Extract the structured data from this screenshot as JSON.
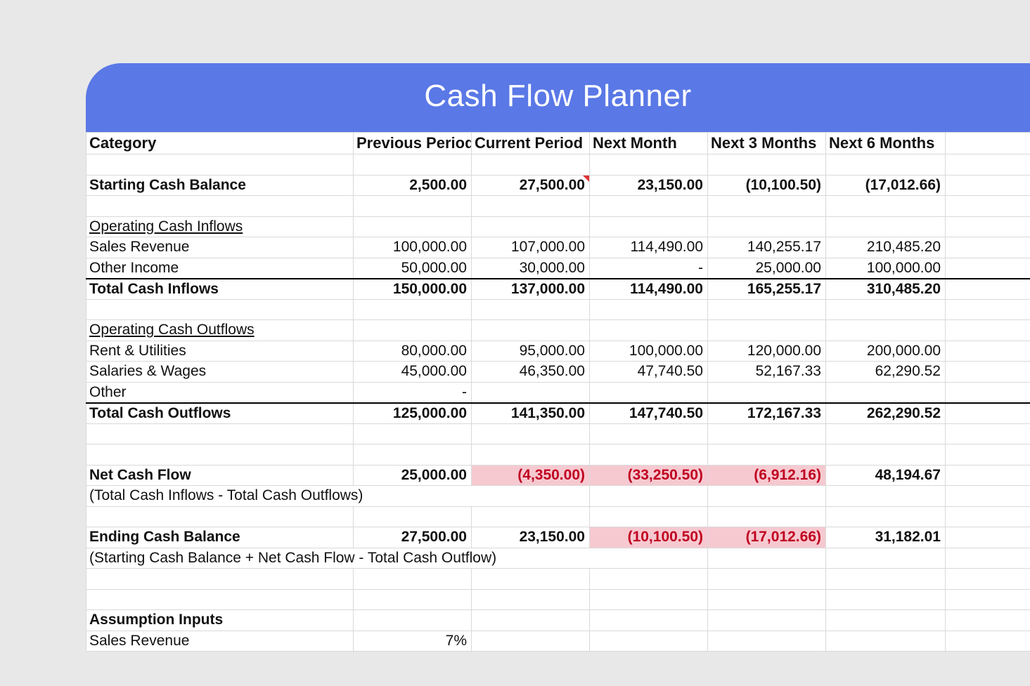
{
  "title": "Cash Flow Planner",
  "columns": [
    "Category",
    "Previous Period",
    "Current Period",
    "Next Month",
    "Next 3 Months",
    "Next 6 Months"
  ],
  "rows": {
    "starting": {
      "label": "Starting Cash Balance",
      "vals": [
        "2,500.00",
        "27,500.00",
        "23,150.00",
        "(10,100.50)",
        "(17,012.66)"
      ],
      "neg": [
        false,
        false,
        false,
        true,
        true
      ]
    },
    "inflows_header": "Operating Cash Inflows",
    "sales": {
      "label": "Sales Revenue",
      "vals": [
        "100,000.00",
        "107,000.00",
        "114,490.00",
        "140,255.17",
        "210,485.20"
      ]
    },
    "other_income": {
      "label": "Other Income",
      "vals": [
        "50,000.00",
        "30,000.00",
        "-",
        "25,000.00",
        "100,000.00"
      ]
    },
    "total_in": {
      "label": "Total Cash Inflows",
      "vals": [
        "150,000.00",
        "137,000.00",
        "114,490.00",
        "165,255.17",
        "310,485.20"
      ]
    },
    "outflows_header": "Operating Cash Outflows",
    "rent": {
      "label": "Rent & Utilities",
      "vals": [
        "80,000.00",
        "95,000.00",
        "100,000.00",
        "120,000.00",
        "200,000.00"
      ]
    },
    "salaries": {
      "label": "Salaries & Wages",
      "vals": [
        "45,000.00",
        "46,350.00",
        "47,740.50",
        "52,167.33",
        "62,290.52"
      ]
    },
    "other": {
      "label": "Other",
      "vals": [
        "-",
        "",
        "",
        "",
        ""
      ]
    },
    "total_out": {
      "label": "Total Cash Outflows",
      "vals": [
        "125,000.00",
        "141,350.00",
        "147,740.50",
        "172,167.33",
        "262,290.52"
      ]
    },
    "net": {
      "label": "Net Cash Flow",
      "vals": [
        "25,000.00",
        "(4,350.00)",
        "(33,250.50)",
        "(6,912.16)",
        "48,194.67"
      ],
      "neg": [
        false,
        true,
        true,
        true,
        false
      ],
      "hl": [
        false,
        true,
        true,
        true,
        false
      ]
    },
    "net_formula": "(Total Cash Inflows - Total Cash Outflows)",
    "ending": {
      "label": "Ending Cash Balance",
      "vals": [
        "27,500.00",
        "23,150.00",
        "(10,100.50)",
        "(17,012.66)",
        "31,182.01"
      ],
      "neg": [
        false,
        false,
        true,
        true,
        false
      ],
      "hl": [
        false,
        false,
        true,
        true,
        false
      ]
    },
    "ending_formula": "(Starting Cash Balance + Net Cash Flow - Total Cash Outflow)",
    "assumption_header": "Assumption Inputs",
    "assumption_sales": {
      "label": "Sales Revenue",
      "vals": [
        "7%",
        "",
        "",
        "",
        ""
      ]
    }
  }
}
